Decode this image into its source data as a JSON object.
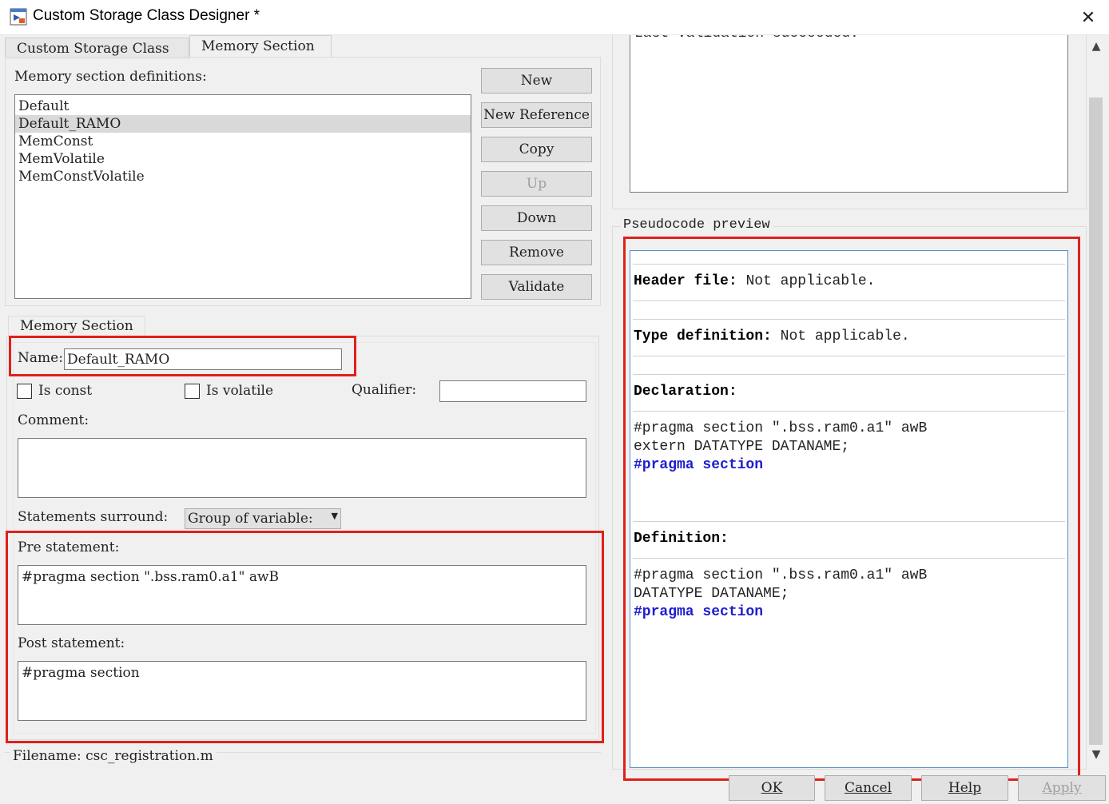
{
  "window": {
    "title": "Custom Storage Class Designer *",
    "close_glyph": "✕"
  },
  "tabs": [
    {
      "label": "Custom Storage Class"
    },
    {
      "label": "Memory Section"
    }
  ],
  "definitions": {
    "label": "Memory section definitions:",
    "items": [
      "Default",
      "Default_RAMO",
      "MemConst",
      "MemVolatile",
      "MemConstVolatile"
    ],
    "selected_index": 1
  },
  "buttons": {
    "new": "New",
    "new_reference": "New Reference",
    "copy": "Copy",
    "up": "Up",
    "down": "Down",
    "remove": "Remove",
    "validate": "Validate"
  },
  "memory_section": {
    "group_label": "Memory Section",
    "name_label": "Name:",
    "name_value": "Default_RAMO",
    "is_const_label": "Is const",
    "is_volatile_label": "Is volatile",
    "qualifier_label": "Qualifier:",
    "qualifier_value": "",
    "comment_label": "Comment:",
    "comment_value": "",
    "statements_label": "Statements surround:",
    "statements_value": "Group of variable:",
    "pre_label": "Pre statement:",
    "pre_value": "#pragma section \".bss.ram0.a1\" awB",
    "post_label": "Post statement:",
    "post_value": "#pragma section"
  },
  "filename": "Filename: csc_registration.m",
  "validation": {
    "text": "Last validation succeeded."
  },
  "preview": {
    "group_label": "Pseudocode preview",
    "header_key": "Header file",
    "header_value": "Not applicable.",
    "typedef_key": "Type definition",
    "typedef_value": "Not applicable.",
    "declaration_key": "Declaration",
    "declaration_lines": [
      "#pragma section \".bss.ram0.a1\" awB",
      "extern DATATYPE DATANAME;"
    ],
    "declaration_end": "#pragma section",
    "definition_key": "Definition",
    "definition_lines": [
      "#pragma section \".bss.ram0.a1\" awB",
      "DATATYPE DATANAME;"
    ],
    "definition_end": "#pragma section"
  },
  "footer_buttons": {
    "ok": "OK",
    "cancel": "Cancel",
    "help": "Help",
    "apply": "Apply"
  },
  "colors": {
    "highlight_box": "#e0201b",
    "keyword_blue": "#1d1dd0"
  }
}
